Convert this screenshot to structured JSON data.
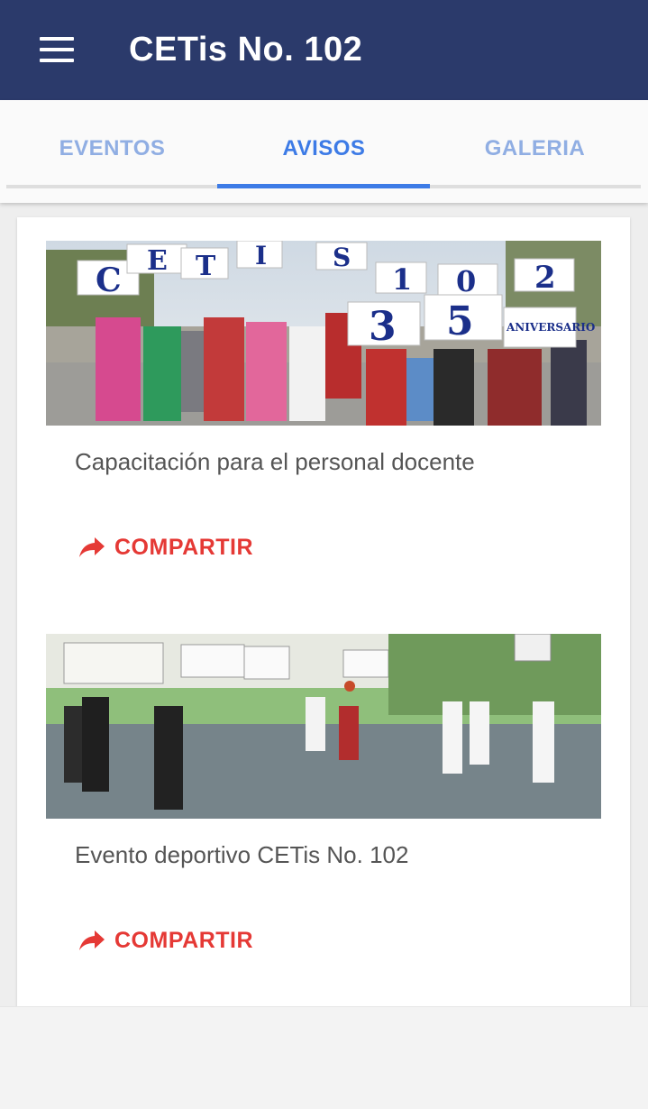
{
  "app": {
    "title": "CETis No. 102"
  },
  "icons": {
    "menu": "menu-icon",
    "share": "share-icon"
  },
  "colors": {
    "appbar": "#2b3a6b",
    "tab_active": "#3d7be6",
    "tab_inactive": "#90aee3",
    "share": "#e53935"
  },
  "tabs": [
    {
      "label": "EVENTOS",
      "active": false
    },
    {
      "label": "AVISOS",
      "active": true
    },
    {
      "label": "GALERIA",
      "active": false
    }
  ],
  "notices": [
    {
      "title": "Capacitación para el personal docente",
      "share_label": "COMPARTIR",
      "image": {
        "sign_letters": [
          "C",
          "E",
          "T",
          "I",
          "S",
          "1",
          "0",
          "2",
          "3",
          "5"
        ],
        "banner": "ANIVERSARIO"
      }
    },
    {
      "title": "Evento deportivo CETis No. 102",
      "share_label": "COMPARTIR",
      "image": {
        "sign_letters": []
      }
    }
  ]
}
